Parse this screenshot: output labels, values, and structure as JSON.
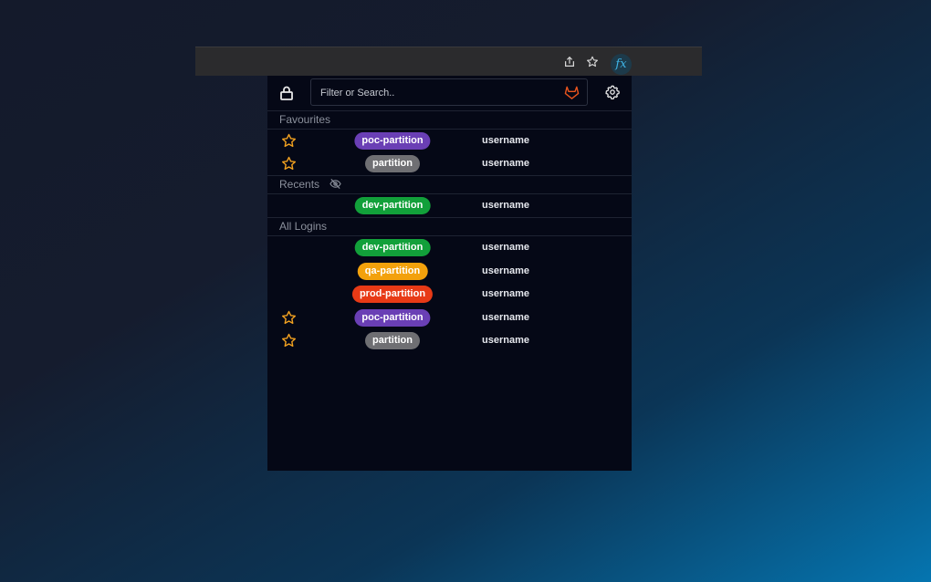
{
  "browser": {
    "extension_label": "fx"
  },
  "search": {
    "placeholder": "Filter or Search.."
  },
  "sections": {
    "favourites": "Favourites",
    "recents": "Recents",
    "all_logins": "All Logins"
  },
  "colors": {
    "poc": "#6a3fb5",
    "default": "#6f6f73",
    "dev": "#12a03a",
    "qa": "#f3a10c",
    "prod": "#e83a16",
    "star": "#f0a020"
  },
  "favourites": [
    {
      "starred": true,
      "partition": "poc-partition",
      "color": "poc",
      "username": "username"
    },
    {
      "starred": true,
      "partition": "partition",
      "color": "default",
      "username": "username"
    }
  ],
  "recents": [
    {
      "starred": false,
      "partition": "dev-partition",
      "color": "dev",
      "username": "username"
    }
  ],
  "all_logins": [
    {
      "starred": false,
      "partition": "dev-partition",
      "color": "dev",
      "username": "username"
    },
    {
      "starred": false,
      "partition": "qa-partition",
      "color": "qa",
      "username": "username"
    },
    {
      "starred": false,
      "partition": "prod-partition",
      "color": "prod",
      "username": "username"
    },
    {
      "starred": true,
      "partition": "poc-partition",
      "color": "poc",
      "username": "username"
    },
    {
      "starred": true,
      "partition": "partition",
      "color": "default",
      "username": "username"
    }
  ]
}
